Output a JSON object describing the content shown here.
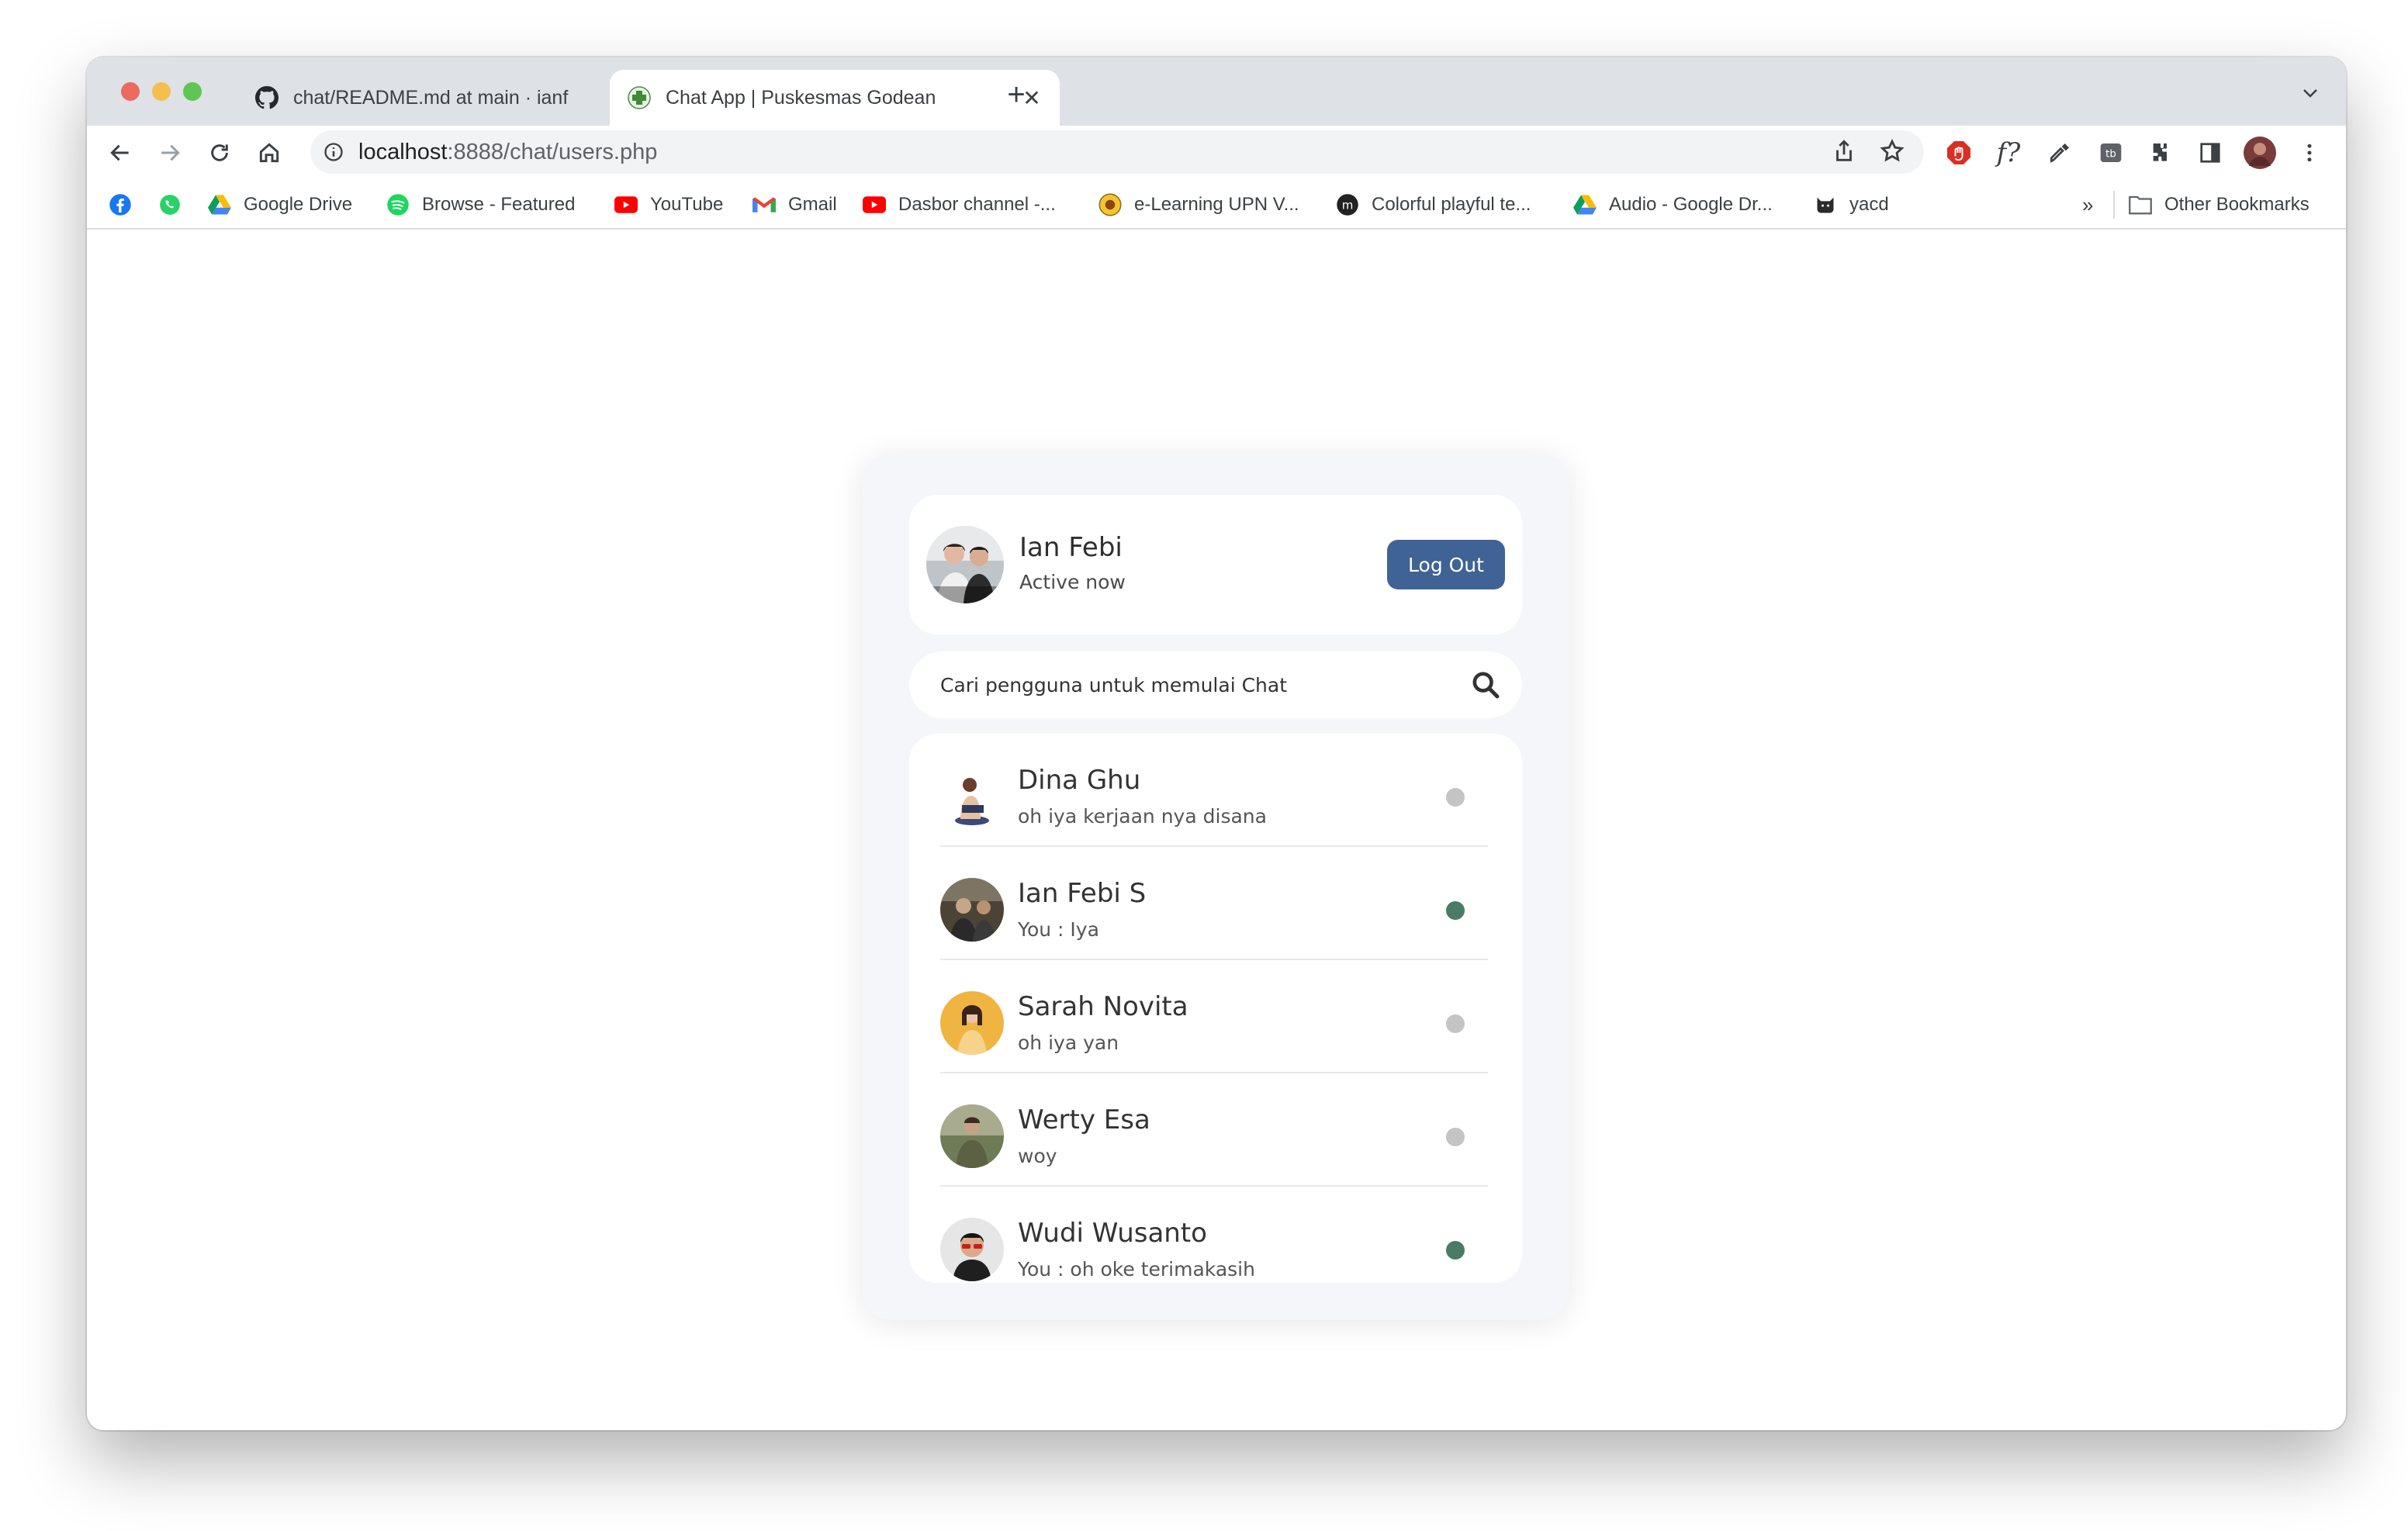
{
  "browser": {
    "tabs": [
      {
        "title": "chat/README.md at main · ianf",
        "icon": "github-icon"
      },
      {
        "title": "Chat App | Puskesmas Godean",
        "icon": "medical-cross-icon"
      }
    ],
    "address": {
      "host": "localhost",
      "path": ":8888/chat/users.php"
    },
    "bookmarks": [
      {
        "label": "",
        "icon": "facebook-icon"
      },
      {
        "label": "",
        "icon": "whatsapp-icon"
      },
      {
        "label": "Google Drive",
        "icon": "google-drive-icon"
      },
      {
        "label": "Browse - Featured",
        "icon": "spotify-icon"
      },
      {
        "label": "YouTube",
        "icon": "youtube-icon"
      },
      {
        "label": "Gmail",
        "icon": "gmail-icon"
      },
      {
        "label": "Dasbor channel -...",
        "icon": "youtube-studio-icon"
      },
      {
        "label": "e-Learning UPN V...",
        "icon": "upn-logo-icon"
      },
      {
        "label": "Colorful playful te...",
        "icon": "m-logo-icon"
      },
      {
        "label": "Audio - Google Dr...",
        "icon": "google-drive-icon"
      },
      {
        "label": "yacd",
        "icon": "cat-icon"
      }
    ],
    "overflow": "»",
    "other_bookmarks": "Other Bookmarks"
  },
  "chat": {
    "current_user": {
      "name": "Ian Febi",
      "status": "Active now"
    },
    "logout_label": "Log Out",
    "search": {
      "placeholder": "Cari pengguna untuk memulai Chat"
    },
    "users": [
      {
        "name": "Dina Ghu",
        "message": "oh iya kerjaan nya disana",
        "online": false
      },
      {
        "name": "Ian Febi S",
        "message": "You : Iya",
        "online": true
      },
      {
        "name": "Sarah Novita",
        "message": "oh iya yan",
        "online": false
      },
      {
        "name": "Werty Esa",
        "message": "woy",
        "online": false
      },
      {
        "name": "Wudi Wusanto",
        "message": "You : oh oke terimakasih",
        "online": true
      }
    ]
  },
  "colors": {
    "online": "#4a7b66",
    "offline": "#c4c4c4",
    "logout_bg": "#3f6394"
  }
}
